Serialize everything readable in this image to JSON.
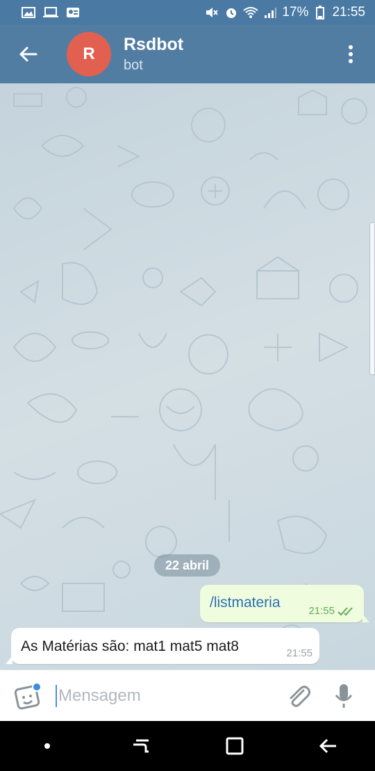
{
  "status_bar": {
    "battery": "17%",
    "time": "21:55",
    "left_icons": [
      "image-icon",
      "laptop-icon",
      "id-card-icon"
    ],
    "right_icons": [
      "mute-icon",
      "alarm-icon",
      "wifi-icon",
      "signal-icon",
      "battery-icon"
    ]
  },
  "header": {
    "avatar_letter": "R",
    "title": "Rsdbot",
    "subtitle": "bot",
    "colors": {
      "bar": "#527da3",
      "avatar": "#e2604f"
    }
  },
  "chat": {
    "date_divider": "22 abril",
    "messages": [
      {
        "direction": "out",
        "text": "/listmateria",
        "time": "21:55",
        "status": "read"
      },
      {
        "direction": "in",
        "text": "As Matérias são: mat1 mat5 mat8",
        "time": "21:55"
      }
    ]
  },
  "composer": {
    "placeholder": "Mensagem",
    "value": ""
  },
  "nav": {
    "buttons": [
      "dot-icon",
      "recents-icon",
      "home-icon",
      "back-icon"
    ]
  }
}
